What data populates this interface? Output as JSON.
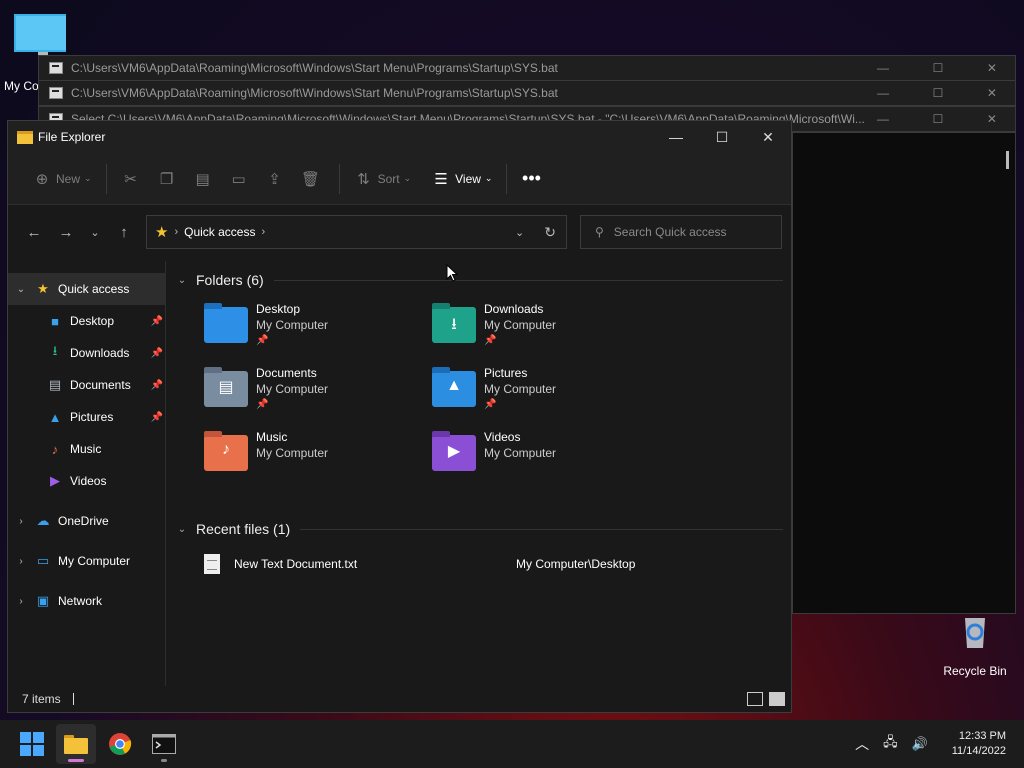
{
  "desktop": {
    "icons": [
      {
        "label": "My Co"
      },
      {
        "label": "Recycle Bin"
      }
    ]
  },
  "console_windows": [
    {
      "title": "C:\\Users\\VM6\\AppData\\Roaming\\Microsoft\\Windows\\Start Menu\\Programs\\Startup\\SYS.bat"
    },
    {
      "title": "C:\\Users\\VM6\\AppData\\Roaming\\Microsoft\\Windows\\Start Menu\\Programs\\Startup\\SYS.bat"
    },
    {
      "title": "Select C:\\Users\\VM6\\AppData\\Roaming\\Microsoft\\Windows\\Start Menu\\Programs\\Startup\\SYS.bat - \"C:\\Users\\VM6\\AppData\\Roaming\\Microsoft\\Wi..."
    }
  ],
  "explorer": {
    "title": "File Explorer",
    "toolbar": {
      "new_label": "New",
      "sort_label": "Sort",
      "view_label": "View"
    },
    "address": {
      "segment": "Quick access"
    },
    "search": {
      "placeholder": "Search Quick access"
    },
    "nav_pane": {
      "quick_access": "Quick access",
      "pinned": [
        {
          "label": "Desktop"
        },
        {
          "label": "Downloads"
        },
        {
          "label": "Documents"
        },
        {
          "label": "Pictures"
        },
        {
          "label": "Music"
        },
        {
          "label": "Videos"
        }
      ],
      "onedrive": "OneDrive",
      "my_computer": "My Computer",
      "network": "Network"
    },
    "folders_header": "Folders (6)",
    "folders": [
      {
        "name": "Desktop",
        "location": "My Computer",
        "color": "#2e8fe6"
      },
      {
        "name": "Downloads",
        "location": "My Computer",
        "color": "#1fa28a"
      },
      {
        "name": "Documents",
        "location": "My Computer",
        "color": "#7a8ca0"
      },
      {
        "name": "Pictures",
        "location": "My Computer",
        "color": "#2b8ee0"
      },
      {
        "name": "Music",
        "location": "My Computer",
        "color": "#e8704a"
      },
      {
        "name": "Videos",
        "location": "My Computer",
        "color": "#8b4fd6"
      }
    ],
    "recent_header": "Recent files (1)",
    "recent_files": [
      {
        "name": "New Text Document.txt",
        "path": "My Computer\\Desktop"
      }
    ],
    "status": {
      "items": "7 items"
    }
  },
  "taskbar": {
    "time": "12:33 PM",
    "date": "11/14/2022"
  }
}
